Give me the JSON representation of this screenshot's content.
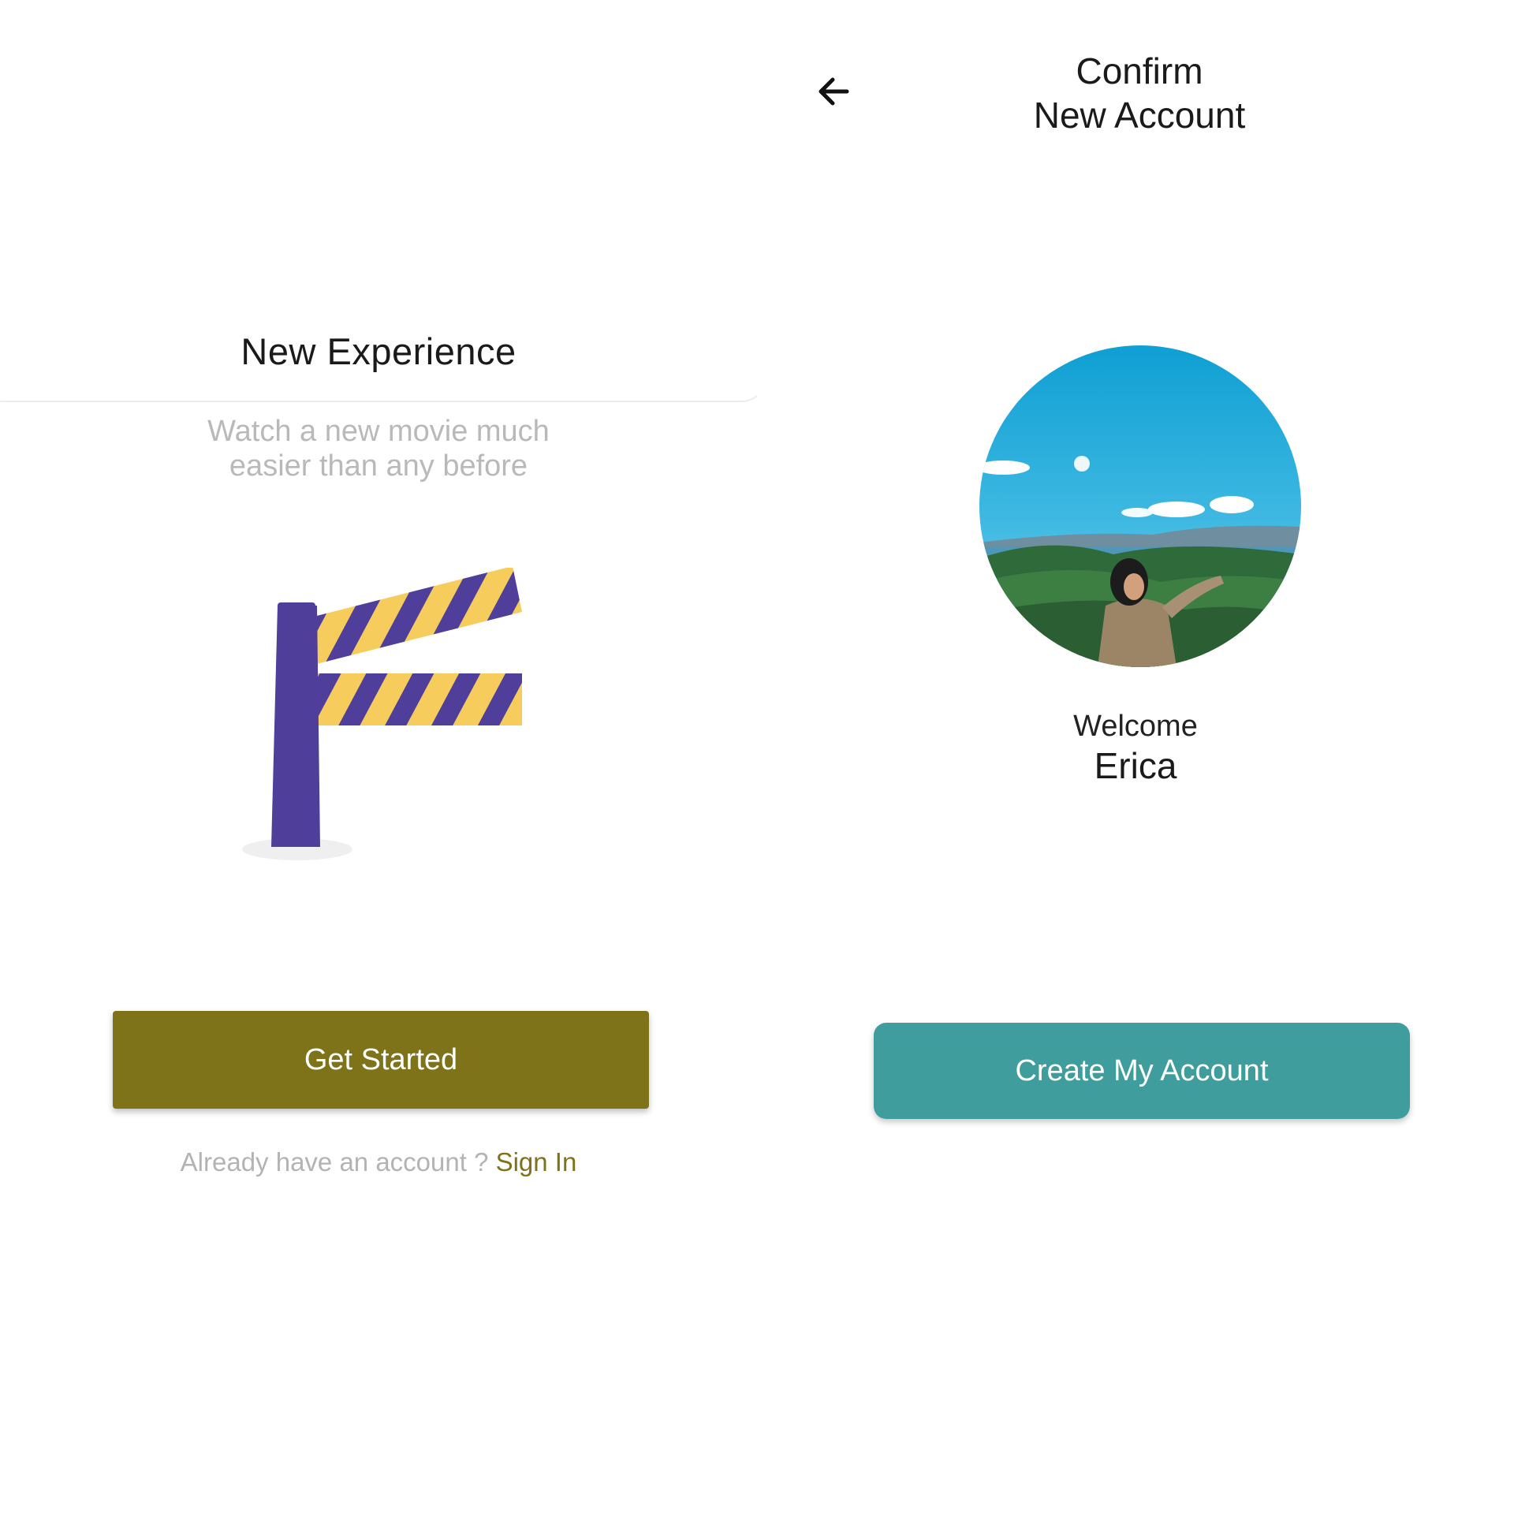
{
  "onboarding": {
    "headline": "New Experience",
    "subtitle": "Watch a new movie much easier than any before",
    "illustration_icon": "road-barrier-icon",
    "get_started_label": "Get Started",
    "signin_prompt": "Already have an account ? ",
    "signin_link": "Sign In"
  },
  "confirm": {
    "back_icon": "back-arrow-icon",
    "title_line1": "Confirm",
    "title_line2": "New Account",
    "avatar_icon": "profile-photo",
    "welcome_label": "Welcome",
    "user_name": "Erica",
    "create_account_label": "Create My Account"
  },
  "colors": {
    "primary_olive": "#7f7319",
    "primary_teal": "#3f9e9d",
    "barrier_purple": "#4f3f9b",
    "barrier_yellow": "#f6cc5d",
    "muted_text": "#b9b9b9"
  }
}
